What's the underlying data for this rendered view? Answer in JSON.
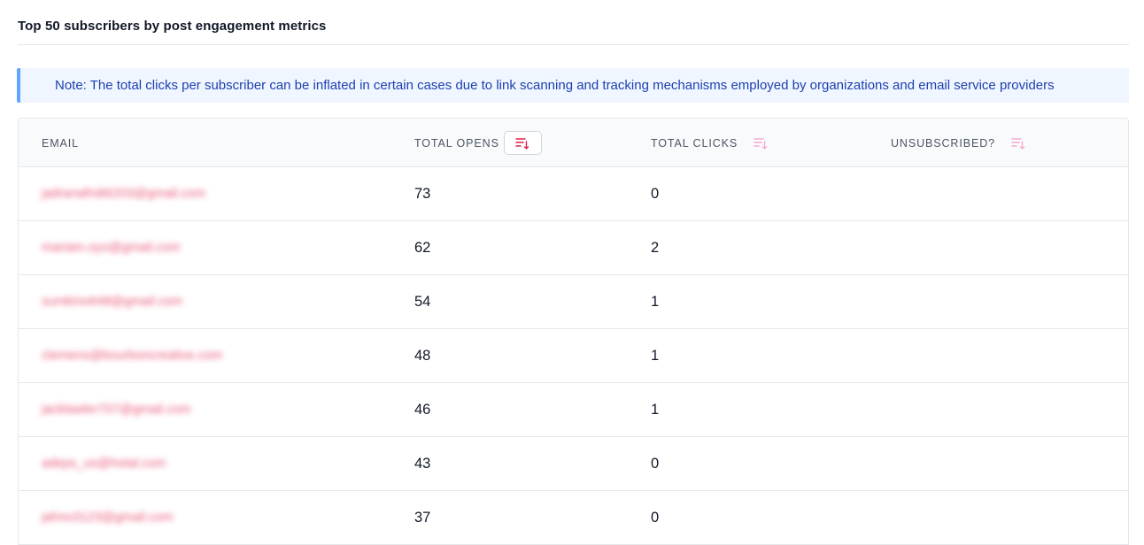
{
  "section": {
    "title": "Top 50 subscribers by post engagement metrics"
  },
  "note": {
    "text": "Note: The total clicks per subscriber can be inflated in certain cases due to link scanning and tracking mechanisms employed by organizations and email service providers"
  },
  "table": {
    "columns": {
      "email": "EMAIL",
      "opens": "TOTAL OPENS",
      "clicks": "TOTAL CLICKS",
      "unsubscribed": "UNSUBSCRIBED?"
    },
    "sort_icons": {
      "opens": "sort-descending-icon",
      "clicks": "sort-descending-icon",
      "unsubscribed": "sort-descending-icon"
    },
    "active_sort": "opens",
    "rows": [
      {
        "email": "jadranafridi6203@gmail.com",
        "opens": "73",
        "clicks": "0",
        "unsubscribed": ""
      },
      {
        "email": "mariam.oyo@gmail.com",
        "opens": "62",
        "clicks": "2",
        "unsubscribed": ""
      },
      {
        "email": "sumkino648@gmail.com",
        "opens": "54",
        "clicks": "1",
        "unsubscribed": ""
      },
      {
        "email": "clemens@bourboncreative.com",
        "opens": "48",
        "clicks": "1",
        "unsubscribed": ""
      },
      {
        "email": "jacklawler707@gmail.com",
        "opens": "46",
        "clicks": "1",
        "unsubscribed": ""
      },
      {
        "email": "adeps_us@hotal.com",
        "opens": "43",
        "clicks": "0",
        "unsubscribed": ""
      },
      {
        "email": "jahno3123@gmail.com",
        "opens": "37",
        "clicks": "0",
        "unsubscribed": ""
      }
    ]
  },
  "colors": {
    "accent": "#e11d48",
    "note_bg": "#eff6ff",
    "note_border": "#60a5fa",
    "note_text": "#1e40af",
    "sort_active": "#e11d48",
    "sort_inactive": "#f9a8d4"
  }
}
